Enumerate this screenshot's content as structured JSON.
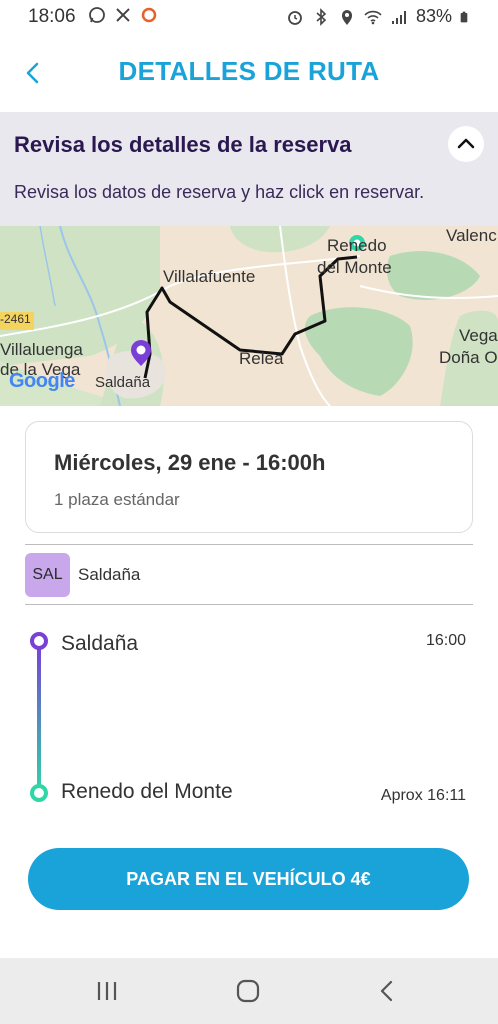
{
  "status_bar": {
    "time": "18:06",
    "battery": "83%",
    "left_icons": [
      "whatsapp-icon",
      "x-icon",
      "record-icon"
    ],
    "right_icons": [
      "alarm-icon",
      "bluetooth-icon",
      "location-icon",
      "wifi-icon",
      "signal-icon",
      "battery-icon"
    ]
  },
  "header": {
    "title": "DETALLES DE RUTA",
    "back_icon": "chevron-left-icon"
  },
  "review": {
    "title": "Revisa los detalles de la reserva",
    "text": "Revisa los datos de reserva y haz click en reservar.",
    "toggle_icon": "chevron-up-icon"
  },
  "map": {
    "labels": {
      "renedo_1": "Renedo",
      "renedo_2": "del Monte",
      "valencia": "Valenc",
      "villalafuente": "Villalafuente",
      "road": "-2461",
      "villaluenga_1": "Villaluenga",
      "villaluenga_2": "de la Vega",
      "saldana": "Saldaña",
      "relea": "Relea",
      "vega_1": "Vega",
      "vega_2": "Doña O",
      "google": "Google"
    }
  },
  "trip": {
    "date": "Miércoles,  29 ene - 16:00h",
    "seats": "1 plaza estándar"
  },
  "stop_tag": {
    "code": "SAL",
    "name": "Saldaña"
  },
  "route": {
    "origin_name": "Saldaña",
    "origin_time": "16:00",
    "destination_name": "Renedo del Monte",
    "destination_time": "Aprox 16:11"
  },
  "pay_button": {
    "label": "PAGAR EN EL VEHÍCULO 4€"
  },
  "nav_bar": {
    "icons": [
      "recent-apps-icon",
      "home-icon",
      "back-nav-icon"
    ]
  }
}
